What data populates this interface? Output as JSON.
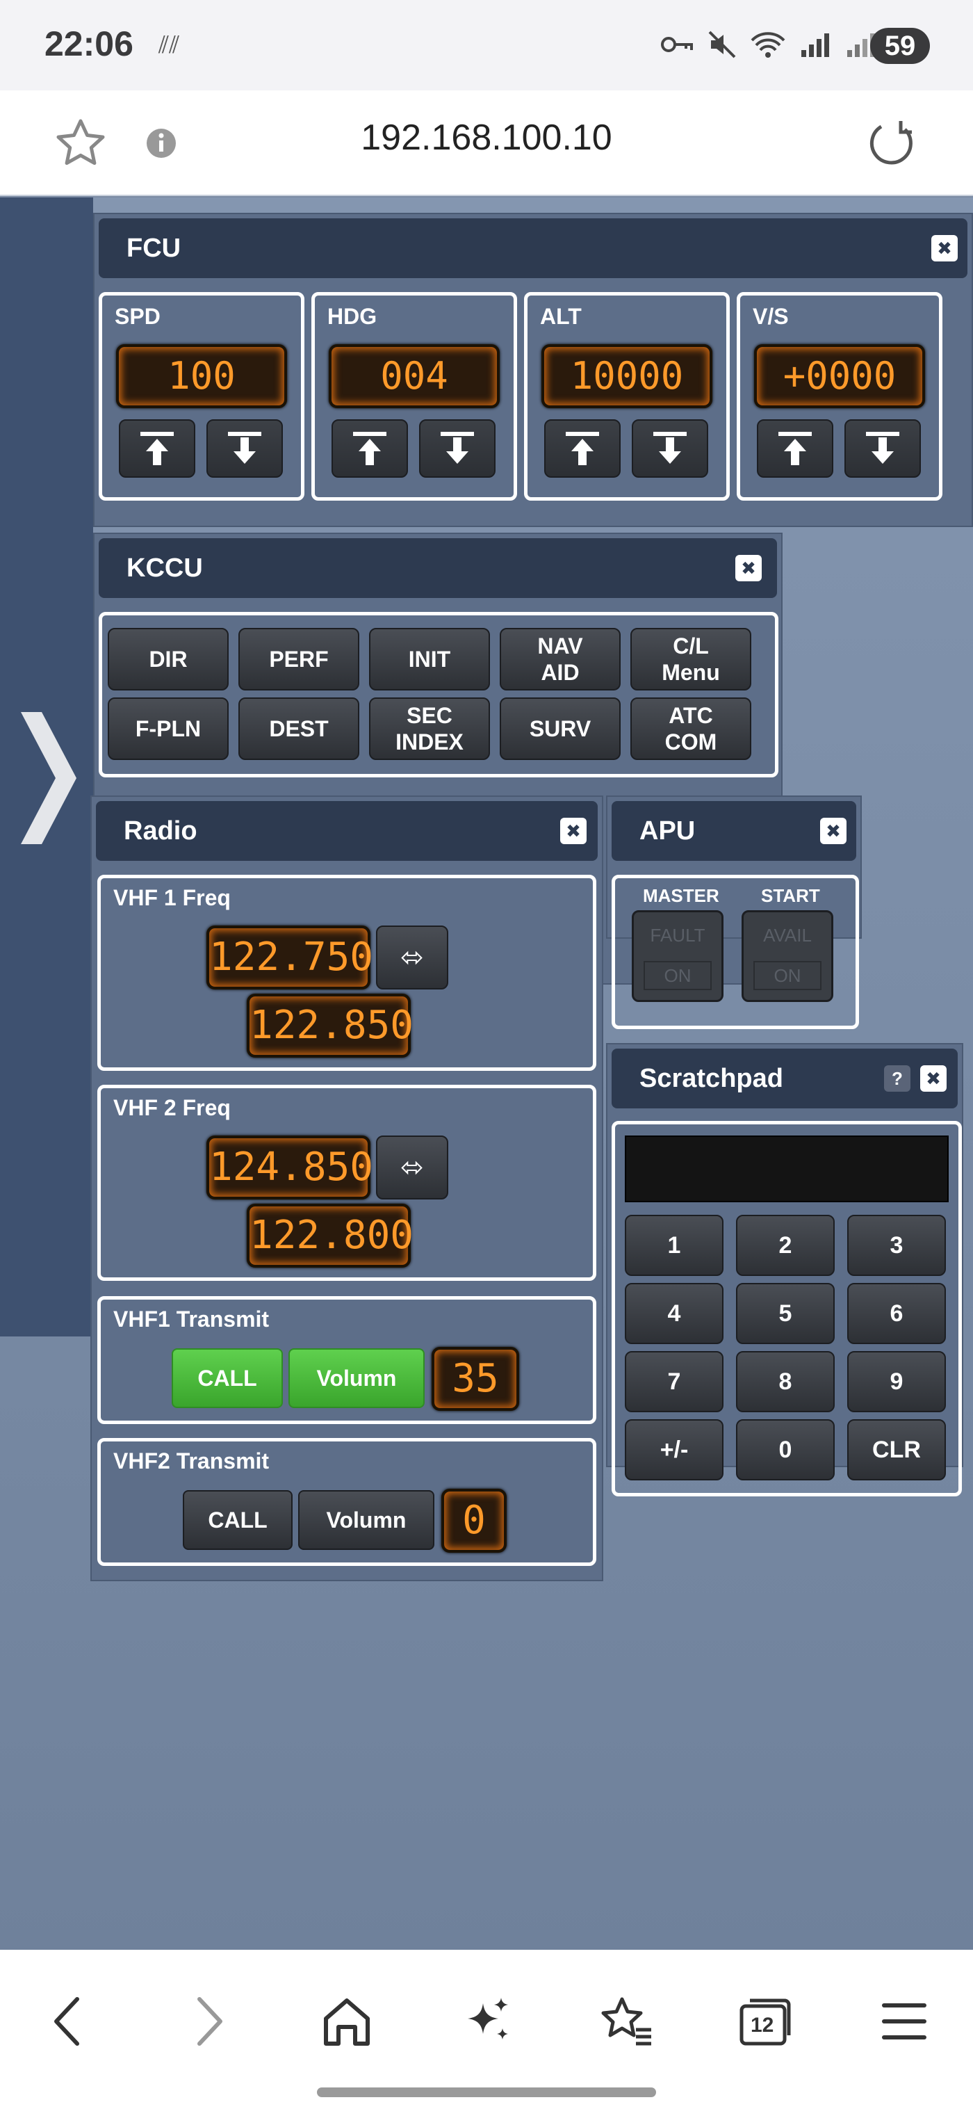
{
  "status_bar": {
    "time": "22:06",
    "battery": "59"
  },
  "browser": {
    "url": "192.168.100.10",
    "tab_count": "12"
  },
  "fcu": {
    "title": "FCU",
    "sections": [
      {
        "label": "SPD",
        "value": "100"
      },
      {
        "label": "HDG",
        "value": "004"
      },
      {
        "label": "ALT",
        "value": "10000"
      },
      {
        "label": "V/S",
        "value": "+0000"
      }
    ]
  },
  "kccu": {
    "title": "KCCU",
    "buttons": [
      "DIR",
      "PERF",
      "INIT",
      "NAV\nAID",
      "C/L\nMenu",
      "F-PLN",
      "DEST",
      "SEC\nINDEX",
      "SURV",
      "ATC\nCOM"
    ]
  },
  "radio": {
    "title": "Radio",
    "vhf1": {
      "label": "VHF 1 Freq",
      "active": "122.750",
      "standby": "122.850"
    },
    "vhf2": {
      "label": "VHF 2 Freq",
      "active": "124.850",
      "standby": "122.800"
    },
    "tx1": {
      "label": "VHF1 Transmit",
      "call": "CALL",
      "volume": "Volumn",
      "value": "35"
    },
    "tx2": {
      "label": "VHF2 Transmit",
      "call": "CALL",
      "volume": "Volumn",
      "value": "0"
    },
    "swap_symbol": "⬄"
  },
  "apu": {
    "title": "APU",
    "master": {
      "label": "MASTER",
      "top": "FAULT",
      "bottom": "ON"
    },
    "start": {
      "label": "START",
      "top": "AVAIL",
      "bottom": "ON"
    }
  },
  "scratchpad": {
    "title": "Scratchpad",
    "help": "?",
    "display": "",
    "keys": [
      "1",
      "2",
      "3",
      "4",
      "5",
      "6",
      "7",
      "8",
      "9",
      "+/-",
      "0",
      "CLR"
    ]
  },
  "colors": {
    "display_text": "#ff9a2a",
    "panel": "#5d6e89",
    "title_bar": "#2d3a50",
    "green": "#4bbf3a"
  }
}
